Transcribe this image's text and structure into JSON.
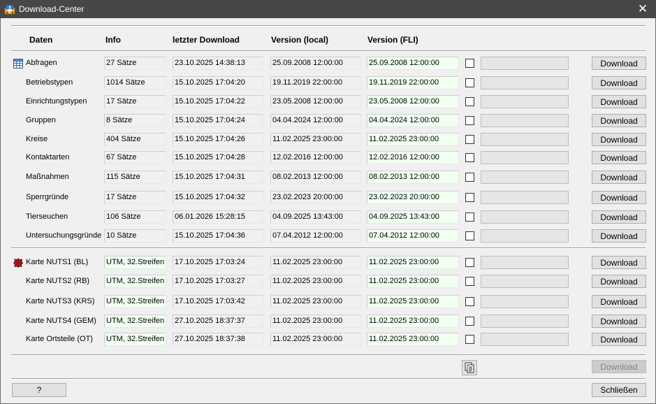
{
  "window": {
    "title": "Download-Center",
    "close_glyph": "✕",
    "icon": "download-center-app-icon"
  },
  "headers": {
    "daten": "Daten",
    "info": "Info",
    "last": "letzter Download",
    "local": "Version (local)",
    "fli": "Version (FLI)"
  },
  "tables": [
    {
      "name": "Abfragen",
      "icon": "table-grid-icon",
      "info": "27 Sätze",
      "last": "23.10.2025 14:38:13",
      "local": "25.09.2008 12:00:00",
      "fli": "25.09.2008 12:00:00",
      "button": "Download"
    },
    {
      "name": "Betriebstypen",
      "info": "1014 Sätze",
      "last": "15.10.2025 17:04:20",
      "local": "19.11.2019 22:00:00",
      "fli": "19.11.2019 22:00:00",
      "button": "Download"
    },
    {
      "name": "Einrichtungstypen",
      "info": "17 Sätze",
      "last": "15.10.2025 17:04:22",
      "local": "23.05.2008 12:00:00",
      "fli": "23.05.2008 12:00:00",
      "button": "Download"
    },
    {
      "name": "Gruppen",
      "info": "8 Sätze",
      "last": "15.10.2025 17:04:24",
      "local": "04.04.2024 12:00:00",
      "fli": "04.04.2024 12:00:00",
      "button": "Download"
    },
    {
      "name": "Kreise",
      "info": "404 Sätze",
      "last": "15.10.2025 17:04:26",
      "local": "11.02.2025 23:00:00",
      "fli": "11.02.2025 23:00:00",
      "button": "Download"
    },
    {
      "name": "Kontaktarten",
      "info": "67 Sätze",
      "last": "15.10.2025 17:04:28",
      "local": "12.02.2016 12:00:00",
      "fli": "12.02.2016 12:00:00",
      "button": "Download"
    },
    {
      "name": "Maßnahmen",
      "info": "115 Sätze",
      "last": "15.10.2025 17:04:31",
      "local": "08.02.2013 12:00:00",
      "fli": "08.02.2013 12:00:00",
      "button": "Download"
    },
    {
      "name": "Sperrgründe",
      "info": "17 Sätze",
      "last": "15.10.2025 17:04:32",
      "local": "23.02.2023 20:00:00",
      "fli": "23.02.2023 20:00:00",
      "button": "Download"
    },
    {
      "name": "Tierseuchen",
      "info": "106 Sätze",
      "last": "06.01.2026 15:28:15",
      "local": "04.09.2025 13:43:00",
      "fli": "04.09.2025 13:43:00",
      "button": "Download"
    },
    {
      "name": "Untersuchungsgründe",
      "info": "10 Sätze",
      "last": "15.10.2025 17:04:36",
      "local": "07.04.2012 12:00:00",
      "fli": "07.04.2012 12:00:00",
      "button": "Download"
    }
  ],
  "maps": [
    {
      "name": "Karte NUTS1 (BL)",
      "icon": "map-region-icon",
      "info": "UTM, 32.Streifen",
      "last": "17.10.2025 17:03:24",
      "local": "11.02.2025 23:00:00",
      "fli": "11.02.2025 23:00:00",
      "button": "Download"
    },
    {
      "name": "Karte NUTS2 (RB)",
      "info": "UTM, 32.Streifen",
      "last": "17.10.2025 17:03:27",
      "local": "11.02.2025 23:00:00",
      "fli": "11.02.2025 23:00:00",
      "button": "Download"
    },
    {
      "name": "Karte NUTS3 (KRS)",
      "info": "UTM, 32.Streifen",
      "last": "17.10.2025 17:03:42",
      "local": "11.02.2025 23:00:00",
      "fli": "11.02.2025 23:00:00",
      "button": "Download"
    },
    {
      "name": "Karte NUTS4 (GEM)",
      "info": "UTM, 32.Streifen",
      "last": "27.10.2025 18:37:37",
      "local": "11.02.2025 23:00:00",
      "fli": "11.02.2025 23:00:00",
      "button": "Download"
    },
    {
      "name": "Karte Ortsteile (OT)",
      "info": "UTM, 32.Streifen",
      "last": "27.10.2025 18:37:38",
      "local": "11.02.2025 23:00:00",
      "fli": "11.02.2025 23:00:00",
      "button": "Download"
    }
  ],
  "footer": {
    "copy_icon": "copy-documents-icon",
    "download_all": "Download",
    "help": "?",
    "close": "Schließen"
  },
  "colors": {
    "titlebar": "#474747",
    "fli_field_bg": "#f0fff0",
    "window_bg": "#f0f0f0"
  }
}
